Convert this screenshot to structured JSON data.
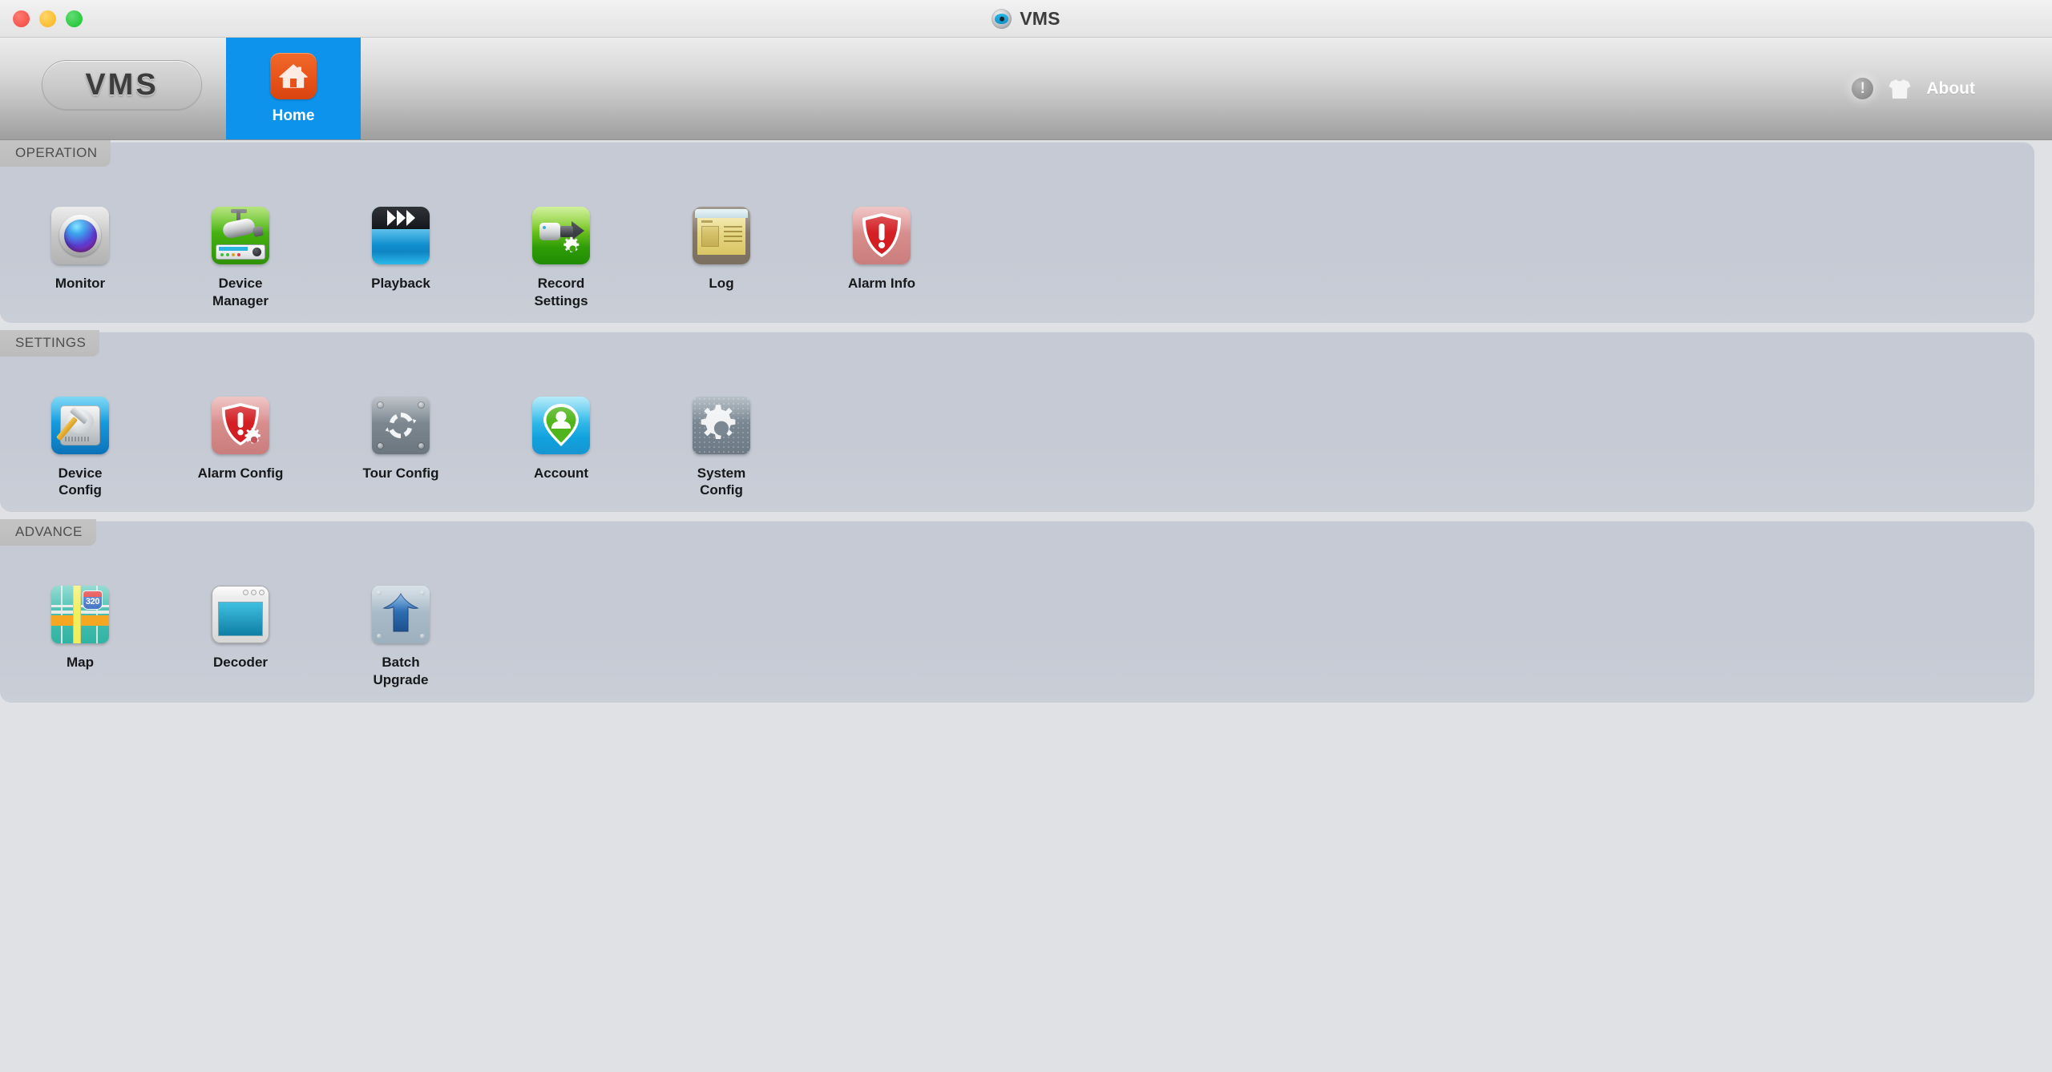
{
  "window": {
    "title": "VMS",
    "app_icon": "camera-eye-icon",
    "traffic_lights": {
      "close": "#f4544b",
      "minimize": "#fbbd2e",
      "maximize": "#2bc840"
    }
  },
  "toolbar": {
    "brand": "VMS",
    "accent_color": "#0d93ec",
    "tabs": [
      {
        "id": "home",
        "label": "Home",
        "icon": "home-icon",
        "active": true
      }
    ],
    "right": {
      "info_glyph": "!",
      "info_icon": "info-icon",
      "skin_icon": "tshirt-icon",
      "about_label": "About"
    }
  },
  "sections": [
    {
      "id": "operation",
      "title": "OPERATION",
      "items": [
        {
          "id": "monitor",
          "label": "Monitor",
          "icon": "monitor-lens-icon"
        },
        {
          "id": "device-manager",
          "label": "Device\nManager",
          "icon": "security-camera-icon"
        },
        {
          "id": "playback",
          "label": "Playback",
          "icon": "clapperboard-fastforward-icon"
        },
        {
          "id": "record-settings",
          "label": "Record\nSettings",
          "icon": "camcorder-gear-icon"
        },
        {
          "id": "log",
          "label": "Log",
          "icon": "document-card-icon"
        },
        {
          "id": "alarm-info",
          "label": "Alarm Info",
          "icon": "red-shield-exclamation-icon"
        }
      ]
    },
    {
      "id": "settings",
      "title": "SETTINGS",
      "items": [
        {
          "id": "device-config",
          "label": "Device\nConfig",
          "icon": "disk-hammer-icon"
        },
        {
          "id": "alarm-config",
          "label": "Alarm Config",
          "icon": "red-shield-gear-icon"
        },
        {
          "id": "tour-config",
          "label": "Tour Config",
          "icon": "refresh-cycle-plate-icon"
        },
        {
          "id": "account",
          "label": "Account",
          "icon": "user-pin-icon"
        },
        {
          "id": "system-config",
          "label": "System\nConfig",
          "icon": "gear-plate-icon"
        }
      ]
    },
    {
      "id": "advance",
      "title": "ADVANCE",
      "items": [
        {
          "id": "map",
          "label": "Map",
          "icon": "road-map-icon",
          "map_route_number": "320"
        },
        {
          "id": "decoder",
          "label": "Decoder",
          "icon": "window-screen-icon"
        },
        {
          "id": "batch-upgrade",
          "label": "Batch\nUpgrade",
          "icon": "blue-up-arrow-plate-icon"
        }
      ]
    }
  ],
  "colors": {
    "panel_bg": "#c5cad4",
    "app_bg": "#dfe1e5",
    "section_tab_bg": "#c0c0c0",
    "tab_active": "#0d93ec",
    "label_text": "#17181a"
  }
}
